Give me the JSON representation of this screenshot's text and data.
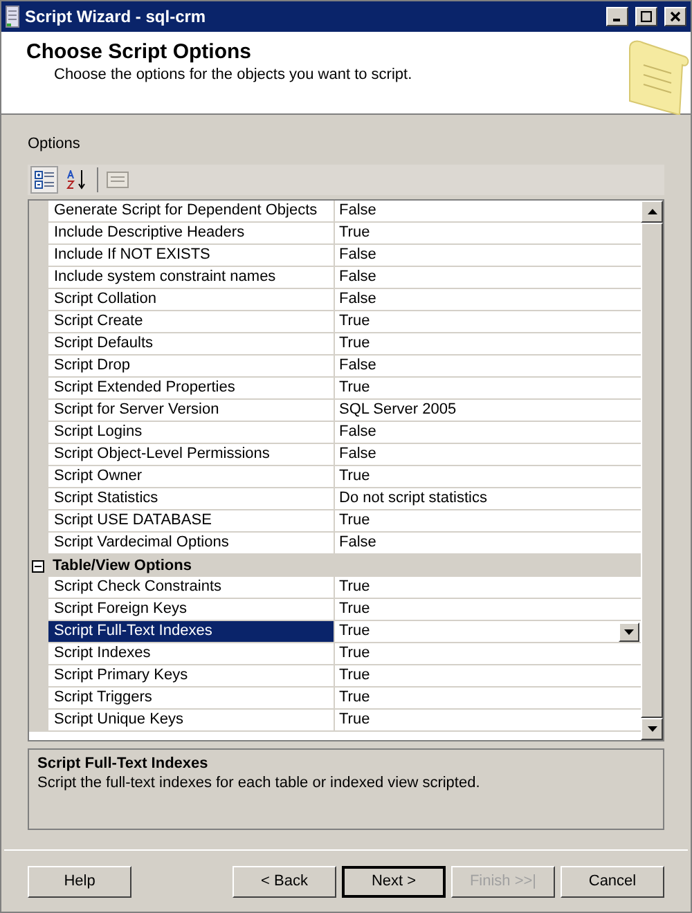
{
  "window": {
    "title": "Script Wizard - sql-crm"
  },
  "header": {
    "title": "Choose Script Options",
    "subtitle": "Choose the options for the objects you want to script."
  },
  "options_label": "Options",
  "toolbar": [
    {
      "kind": "categorized",
      "selected": true
    },
    {
      "kind": "alphabetical",
      "selected": false
    },
    {
      "kind": "pages",
      "selected": false
    }
  ],
  "groups": [
    {
      "rows": [
        {
          "name": "Generate Script for Dependent Objects",
          "value": "False",
          "selected": false
        },
        {
          "name": "Include Descriptive Headers",
          "value": "True",
          "selected": false
        },
        {
          "name": "Include If NOT EXISTS",
          "value": "False",
          "selected": false
        },
        {
          "name": "Include system constraint names",
          "value": "False",
          "selected": false
        },
        {
          "name": "Script Collation",
          "value": "False",
          "selected": false
        },
        {
          "name": "Script Create",
          "value": "True",
          "selected": false
        },
        {
          "name": "Script Defaults",
          "value": "True",
          "selected": false
        },
        {
          "name": "Script Drop",
          "value": "False",
          "selected": false
        },
        {
          "name": "Script Extended Properties",
          "value": "True",
          "selected": false
        },
        {
          "name": "Script for Server Version",
          "value": "SQL Server 2005",
          "selected": false
        },
        {
          "name": "Script Logins",
          "value": "False",
          "selected": false
        },
        {
          "name": "Script Object-Level Permissions",
          "value": "False",
          "selected": false
        },
        {
          "name": "Script Owner",
          "value": "True",
          "selected": false
        },
        {
          "name": "Script Statistics",
          "value": "Do not script statistics",
          "selected": false
        },
        {
          "name": "Script USE DATABASE",
          "value": "True",
          "selected": false
        },
        {
          "name": "Script Vardecimal Options",
          "value": "False",
          "selected": false
        }
      ]
    },
    {
      "title": "Table/View Options",
      "expanded": true,
      "rows": [
        {
          "name": "Script Check Constraints",
          "value": "True",
          "selected": false
        },
        {
          "name": "Script Foreign Keys",
          "value": "True",
          "selected": false
        },
        {
          "name": "Script Full-Text Indexes",
          "value": "True",
          "selected": true
        },
        {
          "name": "Script Indexes",
          "value": "True",
          "selected": false
        },
        {
          "name": "Script Primary Keys",
          "value": "True",
          "selected": false
        },
        {
          "name": "Script Triggers",
          "value": "True",
          "selected": false
        },
        {
          "name": "Script Unique Keys",
          "value": "True",
          "selected": false
        }
      ]
    }
  ],
  "description": {
    "title": "Script Full-Text Indexes",
    "text": "Script the full-text indexes for each table or indexed view scripted."
  },
  "buttons": [
    {
      "label": "Help",
      "disabled": false,
      "default": false
    },
    {
      "label": "< Back",
      "disabled": false,
      "default": false
    },
    {
      "label": "Next >",
      "disabled": false,
      "default": true
    },
    {
      "label": "Finish >>|",
      "disabled": true,
      "default": false
    },
    {
      "label": "Cancel",
      "disabled": false,
      "default": false
    }
  ]
}
